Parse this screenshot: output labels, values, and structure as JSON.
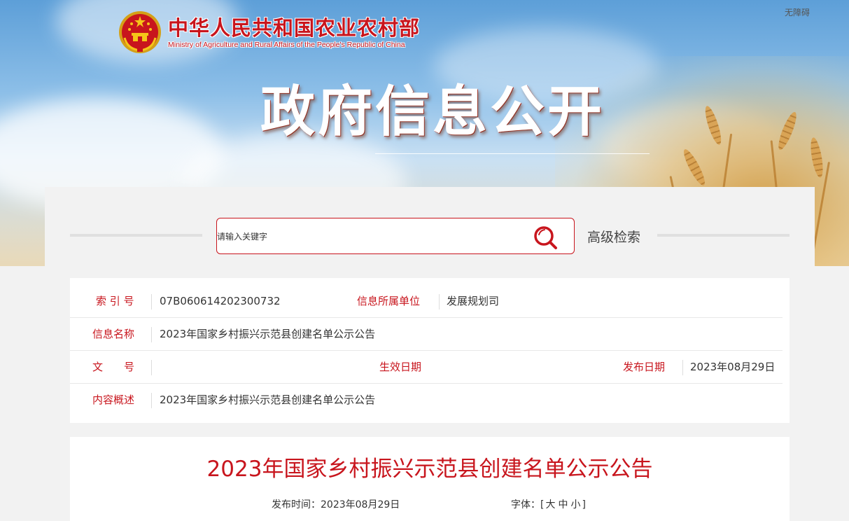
{
  "header": {
    "accessibility_label": "无障碍",
    "logo_cn": "中华人民共和国农业农村部",
    "logo_en": "Ministry of Agriculture and Rural Affairs of the People's Republic of China",
    "page_banner_title": "政府信息公开"
  },
  "search": {
    "placeholder": "请输入关键字",
    "advanced_label": "高级检索"
  },
  "info": {
    "index_label": "索 引 号",
    "index_value": "07B060614202300732",
    "unit_label": "信息所属单位",
    "unit_value": "发展规划司",
    "name_label": "信息名称",
    "name_value": "2023年国家乡村振兴示范县创建名单公示公告",
    "doc_no_label": "文　　号",
    "doc_no_value": "",
    "effective_label": "生效日期",
    "effective_value": "",
    "publish_label": "发布日期",
    "publish_value": "2023年08月29日",
    "summary_label": "内容概述",
    "summary_value": "2023年国家乡村振兴示范县创建名单公示公告"
  },
  "article": {
    "title": "2023年国家乡村振兴示范县创建名单公示公告",
    "pub_time_label": "发布时间：",
    "pub_time_value": "2023年08月29日",
    "font_label": "字体：[",
    "font_large": "大",
    "font_medium": "中",
    "font_small": "小",
    "font_close": "]"
  },
  "colors": {
    "brand_red": "#c8151d",
    "panel_bg": "#f2f2f2"
  }
}
